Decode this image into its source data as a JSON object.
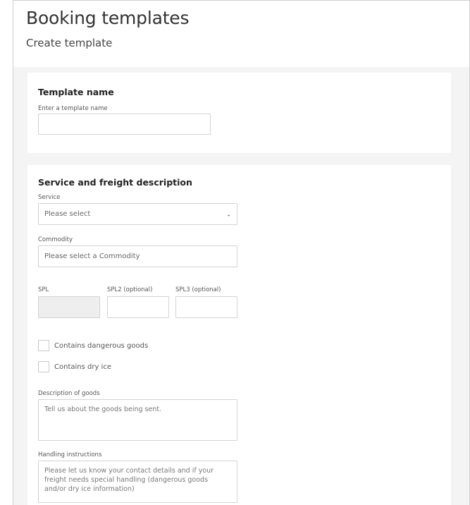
{
  "header": {
    "title": "Booking templates",
    "subtitle": "Create template"
  },
  "template_section": {
    "title": "Template name",
    "name_label": "Enter a template name",
    "name_value": ""
  },
  "service_section": {
    "title": "Service and freight description",
    "service_label": "Service",
    "service_value": "Please select",
    "commodity_label": "Commodity",
    "commodity_placeholder": "Please select a Commodity",
    "spl_label": "SPL",
    "spl2_label": "SPL2 (optional)",
    "spl3_label": "SPL3 (optional)",
    "dangerous_goods_label": "Contains dangerous goods",
    "dry_ice_label": "Contains dry ice",
    "description_label": "Description of goods",
    "description_placeholder": "Tell us about the goods being sent.",
    "handling_label": "Handling instructions",
    "handling_placeholder": "Please let us know your contact details and if your freight needs special handling (dangerous goods and/or dry ice information)"
  },
  "icons": {
    "select_chevron": "chevron-down-icon"
  }
}
